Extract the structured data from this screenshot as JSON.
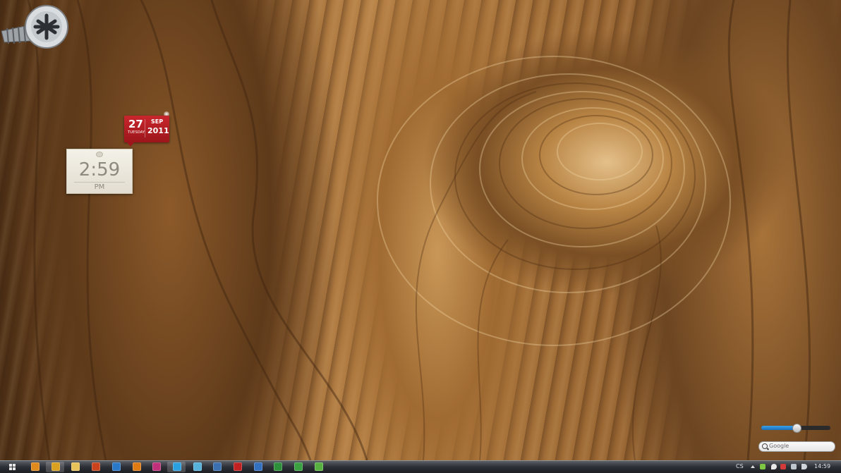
{
  "desktop": {
    "wallpaper": "wood-grain-with-screw"
  },
  "calendar_gadget": {
    "day": "27",
    "weekday": "TUESDAY",
    "month": "SEP",
    "year": "2011",
    "color": "#c8262c"
  },
  "clock_gadget": {
    "time": "2:59",
    "ampm": "PM"
  },
  "volume_slider": {
    "level_percent": 50,
    "accent": "#1a6fb8"
  },
  "search_gadget": {
    "placeholder": "Google",
    "icon": "search-icon"
  },
  "taskbar": {
    "start_icon": "windows-logo-icon",
    "pinned_apps": [
      {
        "name": "media-player-icon",
        "color": "#e08a1e"
      },
      {
        "name": "chrome-icon",
        "color": "#d9a11f"
      },
      {
        "name": "explorer-icon",
        "color": "#e8c35a"
      },
      {
        "name": "office-icon",
        "color": "#c9441c"
      },
      {
        "name": "photoshop-icon",
        "color": "#2a78c8"
      },
      {
        "name": "illustrator-icon",
        "color": "#e07b14"
      },
      {
        "name": "indesign-icon",
        "color": "#c0307a"
      },
      {
        "name": "skype-icon",
        "color": "#2aa0e0"
      },
      {
        "name": "messenger-icon",
        "color": "#56b2d8"
      },
      {
        "name": "download-icon",
        "color": "#3a6fb0"
      },
      {
        "name": "media-center-icon",
        "color": "#c02020"
      },
      {
        "name": "settings-icon",
        "color": "#3470c0"
      },
      {
        "name": "security-icon",
        "color": "#2e8f3a"
      },
      {
        "name": "network-icon",
        "color": "#3aa040"
      },
      {
        "name": "torrent-icon",
        "color": "#58b040"
      }
    ],
    "tray": {
      "language": "CS",
      "time": "14:59"
    }
  }
}
